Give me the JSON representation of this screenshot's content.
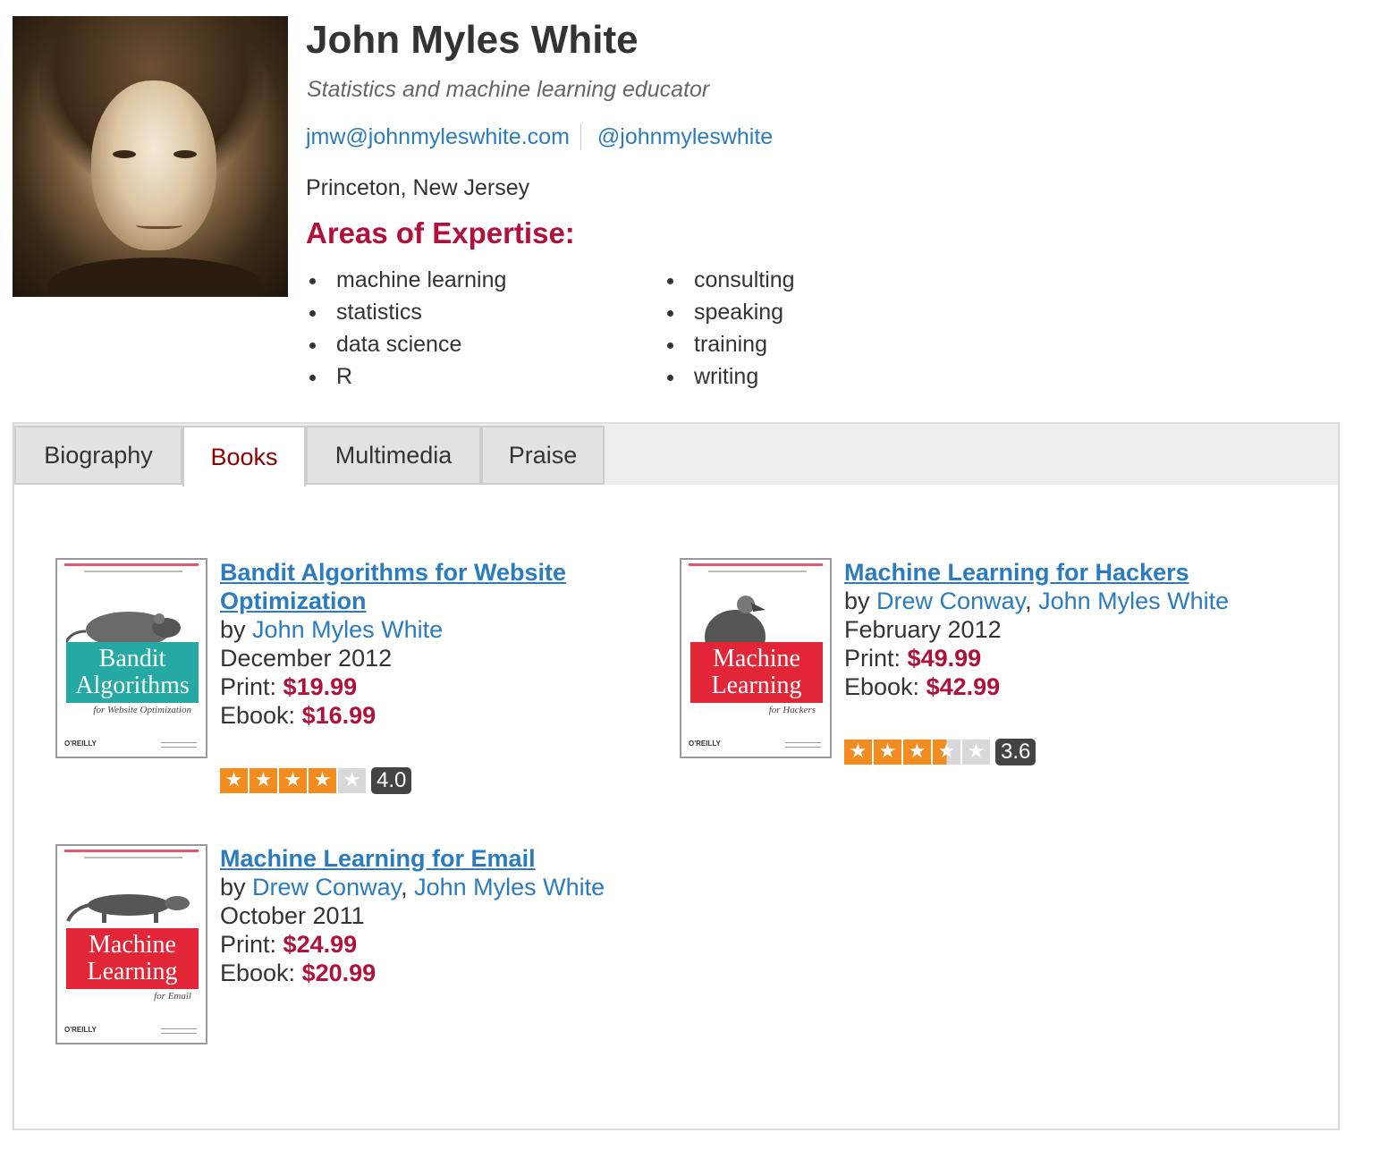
{
  "profile": {
    "name": "John Myles White",
    "tagline": "Statistics and machine learning educator",
    "email": "jmw@johnmyleswhite.com",
    "twitter": "@johnmyleswhite",
    "location": "Princeton, New Jersey",
    "expertise_heading": "Areas of Expertise:",
    "expertise_col1": [
      "machine learning",
      "statistics",
      "data science",
      "R"
    ],
    "expertise_col2": [
      "consulting",
      "speaking",
      "training",
      "writing"
    ]
  },
  "tabs": [
    {
      "label": "Biography",
      "active": false
    },
    {
      "label": "Books",
      "active": true
    },
    {
      "label": "Multimedia",
      "active": false
    },
    {
      "label": "Praise",
      "active": false
    }
  ],
  "books": [
    {
      "title": "Bandit Algorithms for Website Optimization",
      "by": "by",
      "authors": [
        "John Myles White"
      ],
      "date": "December 2012",
      "print_label": "Print:",
      "print_price": "$19.99",
      "ebook_label": "Ebook:",
      "ebook_price": "$16.99",
      "rating": "4.0",
      "rating_value": 4.0,
      "cover": {
        "text": "Bandit Algorithms",
        "subtitle": "for Website Optimization",
        "publisher": "O'REILLY",
        "color": "#24a9a4"
      }
    },
    {
      "title": "Machine Learning for Hackers",
      "by": "by",
      "authors": [
        "Drew Conway",
        "John Myles White"
      ],
      "date": "February 2012",
      "print_label": "Print:",
      "print_price": "$49.99",
      "ebook_label": "Ebook:",
      "ebook_price": "$42.99",
      "rating": "3.6",
      "rating_value": 3.6,
      "cover": {
        "text": "Machine Learning",
        "subtitle": "for Hackers",
        "publisher": "O'REILLY",
        "color": "#e32637"
      }
    },
    {
      "title": "Machine Learning for Email",
      "by": "by",
      "authors": [
        "Drew Conway",
        "John Myles White"
      ],
      "date": "October 2011",
      "print_label": "Print:",
      "print_price": "$24.99",
      "ebook_label": "Ebook:",
      "ebook_price": "$20.99",
      "cover": {
        "text": "Machine Learning",
        "subtitle": "for Email",
        "publisher": "O'REILLY",
        "color": "#e32637"
      }
    }
  ],
  "colors": {
    "link": "#2b7bbf",
    "accent": "#b0103a",
    "star": "#f28c1e",
    "active_tab": "#8b0000"
  }
}
